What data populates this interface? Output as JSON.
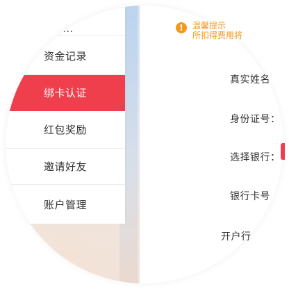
{
  "menu": {
    "items": [
      {
        "label": "…"
      },
      {
        "label": "资金记录"
      },
      {
        "label": "绑卡认证",
        "active": true
      },
      {
        "label": "红包奖励"
      },
      {
        "label": "邀请好友"
      },
      {
        "label": "账户管理"
      }
    ]
  },
  "notice": {
    "icon": "!",
    "line1": "温馨提示",
    "line2": "所扣得费用将"
  },
  "form": {
    "labels": [
      "真实姓名",
      "身份证号：",
      "选择银行：",
      "银行卡号",
      "开户行"
    ]
  },
  "colors": {
    "accent": "#ef3f4d",
    "warning": "#f39a1d"
  }
}
